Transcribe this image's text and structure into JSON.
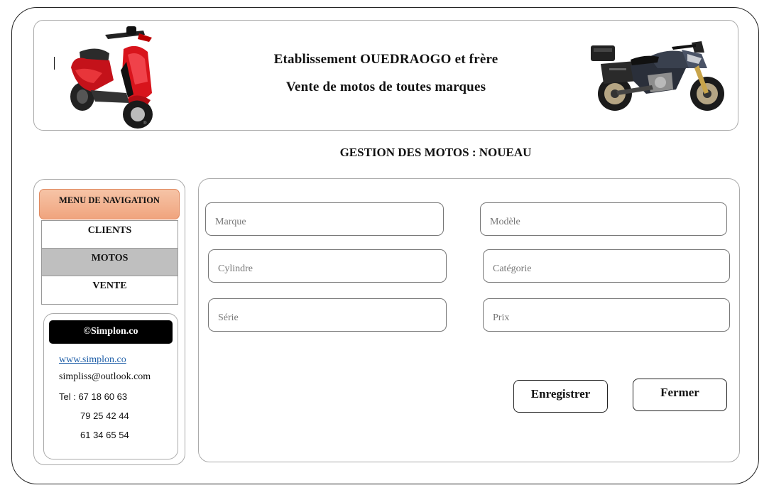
{
  "header": {
    "title": "Etablissement OUEDRAOGO et frère",
    "subtitle": "Vente de motos de toutes marques"
  },
  "page_title": "GESTION DES MOTOS : NOUEAU",
  "sidebar": {
    "nav_header": "MENU DE NAVIGATION",
    "items": [
      {
        "label": "CLIENTS",
        "active": false
      },
      {
        "label": "MOTOS",
        "active": true
      },
      {
        "label": "VENTE",
        "active": false
      }
    ],
    "brand": "©Simplon.co",
    "website": "www.simplon.co",
    "email": "simpliss@outlook.com",
    "tel_label": "Tel : 67 18 60 63",
    "tel_2": "79 25 42 44",
    "tel_3": "61 34 65 54"
  },
  "form": {
    "marque": {
      "placeholder": "Marque",
      "value": ""
    },
    "modele": {
      "placeholder": "Modèle",
      "value": ""
    },
    "cylindre": {
      "placeholder": "Cylindre",
      "value": ""
    },
    "categorie": {
      "placeholder": "Catégorie",
      "value": ""
    },
    "serie": {
      "placeholder": "Série",
      "value": ""
    },
    "prix": {
      "placeholder": "Prix",
      "value": ""
    },
    "save_label": "Enregistrer",
    "close_label": "Fermer"
  },
  "colors": {
    "nav_header_bg": "#f0a47e",
    "active_nav_bg": "#bfbfbf",
    "brand_bg": "#000000",
    "link": "#1f5fa8",
    "scooter_body": "#d8141c",
    "bike_body": "#2a2f3a"
  },
  "icons": {
    "left_image": "red-scooter-image",
    "right_image": "adventure-motorcycle-image"
  }
}
